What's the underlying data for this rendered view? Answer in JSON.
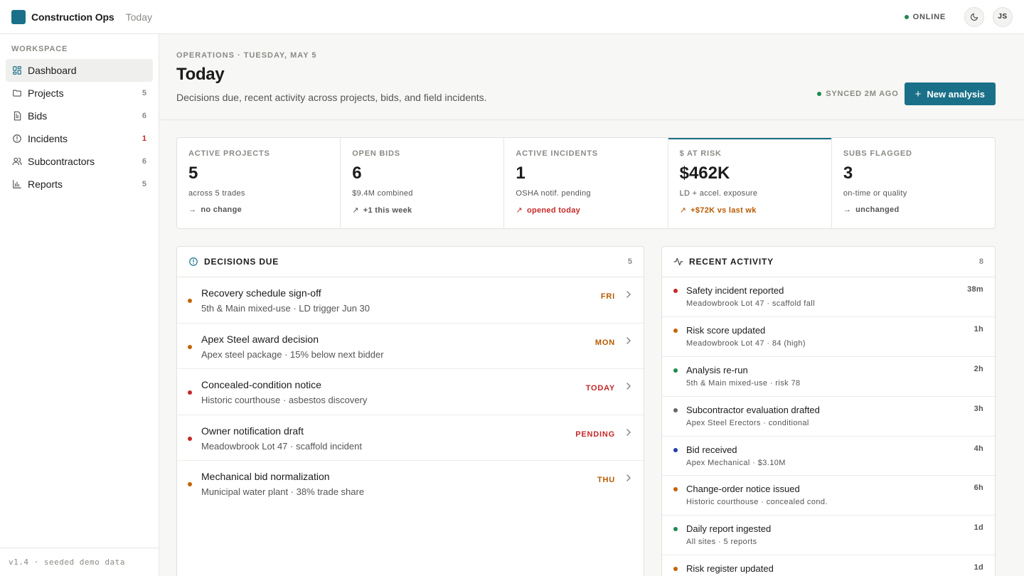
{
  "topbar": {
    "app_name": "Construction Ops",
    "crumb": "Today",
    "status": "ONLINE",
    "theme_icon": "moon-icon",
    "user_initials": "JS"
  },
  "sidebar": {
    "section_label": "WORKSPACE",
    "items": [
      {
        "label": "Dashboard",
        "icon": "dashboard-icon",
        "count": ""
      },
      {
        "label": "Projects",
        "icon": "folder-icon",
        "count": "5"
      },
      {
        "label": "Bids",
        "icon": "document-icon",
        "count": "6"
      },
      {
        "label": "Incidents",
        "icon": "alert-circle-icon",
        "count": "1"
      },
      {
        "label": "Subcontractors",
        "icon": "users-icon",
        "count": "6"
      },
      {
        "label": "Reports",
        "icon": "bar-chart-icon",
        "count": "5"
      }
    ],
    "footer": "v1.4 · seeded demo data"
  },
  "header": {
    "overline": "OPERATIONS · TUESDAY, MAY 5",
    "title": "Today",
    "subtitle": "Decisions due, recent activity across projects, bids, and field incidents.",
    "sync_status": "SYNCED 2M AGO",
    "new_button": "New analysis"
  },
  "kpis": [
    {
      "label": "ACTIVE PROJECTS",
      "value": "5",
      "sub": "across 5 trades",
      "delta": "no change",
      "arrow": "→"
    },
    {
      "label": "OPEN BIDS",
      "value": "6",
      "sub": "$9.4M combined",
      "delta": "+1 this week",
      "arrow": "↗"
    },
    {
      "label": "ACTIVE INCIDENTS",
      "value": "1",
      "sub": "OSHA notif. pending",
      "delta": "opened today",
      "arrow": "↗"
    },
    {
      "label": "$ AT RISK",
      "value": "$462K",
      "sub": "LD + accel. exposure",
      "delta": "+$72K vs last wk",
      "arrow": "↗"
    },
    {
      "label": "SUBS FLAGGED",
      "value": "3",
      "sub": "on-time or quality",
      "delta": "unchanged",
      "arrow": "→"
    }
  ],
  "decisions": {
    "title": "DECISIONS DUE",
    "count": "5",
    "items": [
      {
        "title": "Recovery schedule sign-off",
        "meta": "5th & Main mixed-use · LD trigger Jun 30",
        "due": "FRI"
      },
      {
        "title": "Apex Steel award decision",
        "meta": "Apex steel package · 15% below next bidder",
        "due": "MON"
      },
      {
        "title": "Concealed-condition notice",
        "meta": "Historic courthouse · asbestos discovery",
        "due": "TODAY"
      },
      {
        "title": "Owner notification draft",
        "meta": "Meadowbrook Lot 47 · scaffold incident",
        "due": "PENDING"
      },
      {
        "title": "Mechanical bid normalization",
        "meta": "Municipal water plant · 38% trade share",
        "due": "THU"
      }
    ]
  },
  "activity": {
    "title": "RECENT ACTIVITY",
    "count": "8",
    "items": [
      {
        "title": "Safety incident reported",
        "meta": "Meadowbrook Lot 47 · scaffold fall",
        "time": "38m"
      },
      {
        "title": "Risk score updated",
        "meta": "Meadowbrook Lot 47 · 84 (high)",
        "time": "1h"
      },
      {
        "title": "Analysis re-run",
        "meta": "5th & Main mixed-use · risk 78",
        "time": "2h"
      },
      {
        "title": "Subcontractor evaluation drafted",
        "meta": "Apex Steel Erectors · conditional",
        "time": "3h"
      },
      {
        "title": "Bid received",
        "meta": "Apex Mechanical · $3.10M",
        "time": "4h"
      },
      {
        "title": "Change-order notice issued",
        "meta": "Historic courthouse · concealed cond.",
        "time": "6h"
      },
      {
        "title": "Daily report ingested",
        "meta": "All sites · 5 reports",
        "time": "1d"
      },
      {
        "title": "Risk register updated",
        "meta": "",
        "time": "1d"
      }
    ]
  },
  "colors": {
    "accent": "#1a7088",
    "online": "#1f8a4c",
    "red": "#c62828",
    "orange": "#b85a00",
    "blue": "#1f3fa8",
    "gray": "#666666"
  }
}
